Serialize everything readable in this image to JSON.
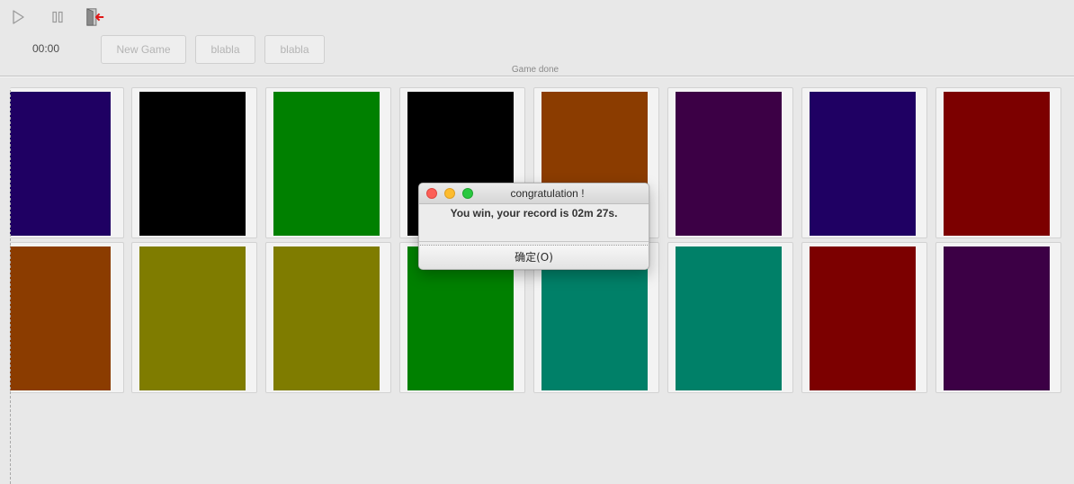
{
  "toolbar": {
    "play_icon": "play-icon",
    "pause_icon": "pause-icon",
    "exit_icon": "exit-door-icon",
    "timer": "00:00",
    "buttons": [
      {
        "label": "New Game"
      },
      {
        "label": "blabla"
      },
      {
        "label": "blabla"
      }
    ],
    "status": "Game done"
  },
  "board": {
    "rows": [
      [
        {
          "color": "#1f0063"
        },
        {
          "color": "#000000"
        },
        {
          "color": "#008000"
        },
        {
          "color": "#000000"
        },
        {
          "color": "#8b3c00"
        },
        {
          "color": "#3c0045"
        },
        {
          "color": "#1f0063"
        },
        {
          "color": "#7c0000"
        }
      ],
      [
        {
          "color": "#8b3c00"
        },
        {
          "color": "#7f7c00"
        },
        {
          "color": "#7f7c00"
        },
        {
          "color": "#008000"
        },
        {
          "color": "#008068"
        },
        {
          "color": "#008068"
        },
        {
          "color": "#7c0000"
        },
        {
          "color": "#3c0045"
        }
      ]
    ]
  },
  "dialog": {
    "title": "congratulation !",
    "message": "You win, your record is 02m 27s.",
    "ok_label": "确定(O)"
  }
}
